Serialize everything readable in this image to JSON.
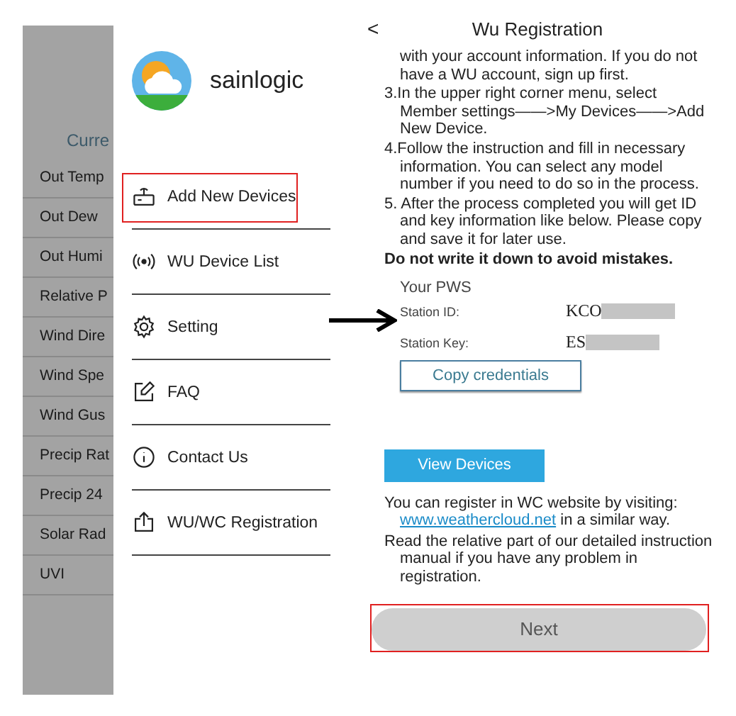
{
  "background_screen": {
    "header": "Curre",
    "rows": [
      "Out Temp",
      "Out Dew",
      "Out Humi",
      "Relative P",
      "Wind Dire",
      "Wind Spe",
      "Wind Gus",
      "Precip Rat",
      "Precip 24",
      "Solar Rad",
      "UVI"
    ]
  },
  "drawer": {
    "brand": "sainlogic",
    "items": [
      {
        "label": "Add New Devices",
        "highlighted": true
      },
      {
        "label": "WU Device List",
        "highlighted": false
      },
      {
        "label": "Setting",
        "highlighted": false
      },
      {
        "label": "FAQ",
        "highlighted": false
      },
      {
        "label": "Contact Us",
        "highlighted": false
      },
      {
        "label": "WU/WC Registration",
        "highlighted": false
      }
    ]
  },
  "registration": {
    "back": "<",
    "title": "Wu Registration",
    "steps": [
      "with your account information. If you do not have a WU account, sign up first.",
      "3.In the upper right corner menu, select Member settings——>My Devices——>Add New Device.",
      "4.Follow the instruction and fill in necessary information. You can select any model number if you need to do so in the process.",
      "5. After the process completed you will get ID and key information like below. Please copy and save it for later use."
    ],
    "warning": "Do not write it down to avoid mistakes.",
    "pws": {
      "heading": "Your PWS",
      "fields": [
        {
          "label": "Station ID:",
          "value": "KCO"
        },
        {
          "label": "Station Key:",
          "value": "ES"
        }
      ],
      "copy_button": "Copy credentials"
    },
    "view_button": "View Devices",
    "wc_note": {
      "before": "You can register in WC website by visiting: ",
      "link": "www.weathercloud.net",
      "after": " in a similar way."
    },
    "manual_note": "Read the relative part of our detailed instruction manual if you have any problem in registration.",
    "next_button": {
      "label": "Next",
      "highlighted": true
    }
  }
}
